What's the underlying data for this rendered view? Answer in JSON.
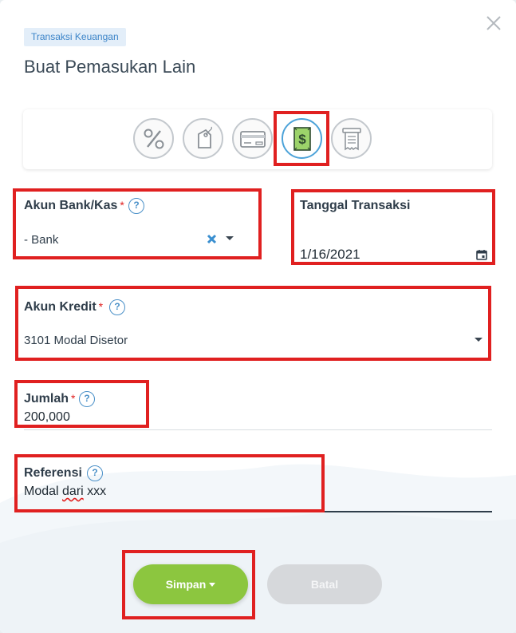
{
  "header": {
    "badge": "Transaksi Keuangan",
    "title": "Buat Pemasukan Lain"
  },
  "type_selector": {
    "items": [
      {
        "icon": "percent-icon"
      },
      {
        "icon": "price-tag-icon"
      },
      {
        "icon": "credit-card-icon"
      },
      {
        "icon": "dollar-bill-icon",
        "selected": true
      },
      {
        "icon": "receipt-icon"
      }
    ]
  },
  "form": {
    "bank_account": {
      "label": "Akun Bank/Kas",
      "required_mark": "*",
      "help": "?",
      "value": "- Bank"
    },
    "transaction_date": {
      "label": "Tanggal Transaksi",
      "value": "1/16/2021"
    },
    "credit_account": {
      "label": "Akun Kredit",
      "required_mark": "*",
      "help": "?",
      "value": "3101 Modal Disetor"
    },
    "amount": {
      "label": "Jumlah",
      "required_mark": "*",
      "help": "?",
      "value": "200,000"
    },
    "reference": {
      "label": "Referensi",
      "help": "?",
      "value_prefix": "Modal ",
      "value_misspelled": "dari",
      "value_suffix": " xxx"
    }
  },
  "actions": {
    "save_label": "Simpan",
    "cancel_label": "Batal"
  },
  "colors": {
    "accent_green": "#8cc63f",
    "highlight_red": "#e02020",
    "help_blue": "#4a90c8"
  }
}
